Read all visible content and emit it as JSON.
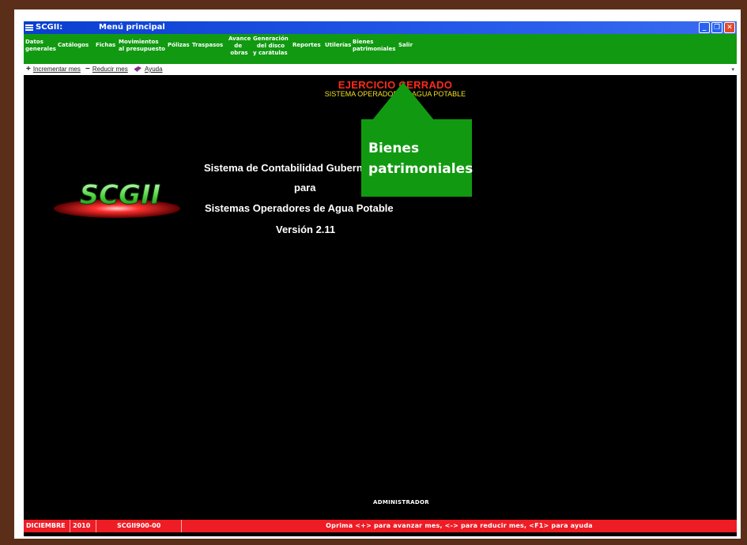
{
  "window": {
    "app_title": "SCGII:",
    "subtitle": "Menú principal",
    "controls": {
      "minimize": "_",
      "restore": "❐",
      "close": "✕"
    }
  },
  "menu": [
    {
      "id": "datos",
      "label": "Datos\ngenerales"
    },
    {
      "id": "catalogos",
      "label": "Catálogos"
    },
    {
      "id": "fichas",
      "label": "Fichas"
    },
    {
      "id": "movimientos",
      "label": "Movimientos\nal presupuesto"
    },
    {
      "id": "polizas",
      "label": "Pólizas"
    },
    {
      "id": "traspasos",
      "label": "Traspasos"
    },
    {
      "id": "avance",
      "label": "Avance\n   de\n obras"
    },
    {
      "id": "generacion",
      "label": "Generación\n  del disco\ny carátulas"
    },
    {
      "id": "reportes",
      "label": "Reportes"
    },
    {
      "id": "utilerias",
      "label": "Utilerías"
    },
    {
      "id": "bienes",
      "label": "Bienes\npatrimoniales"
    },
    {
      "id": "salir",
      "label": "Salir"
    }
  ],
  "toolbar": {
    "increment": {
      "glyph": "+",
      "label": "Incrementar mes"
    },
    "decrement": {
      "glyph": "−",
      "label": "Reducir mes"
    },
    "help": {
      "label": "Ayuda"
    }
  },
  "main": {
    "exercise_status": "EJERCICIO CERRADO",
    "system_name": "SISTEMA OPERADOR DE AGUA POTABLE",
    "logo_text": "SCGII",
    "line1": "Sistema de Contabilidad Gubernamental",
    "line2": "para",
    "line3": "Sistemas Operadores de Agua Potable",
    "version": "Versión 2.11",
    "user": "ADMINISTRADOR"
  },
  "callout": {
    "text": "Bienes\npatrimoniales"
  },
  "status": {
    "month": "DICIEMBRE",
    "year": "2010",
    "code": "SCGII900-00",
    "message": "Oprima <+> para avanzar mes, <-> para reducir mes, <F1> para ayuda"
  },
  "colors": {
    "menubar": "#119a11",
    "titlebar": "#0a3fd0",
    "statusbar": "#ee1c25",
    "exercise": "#ff2a1a",
    "system_name": "#f0e020"
  }
}
